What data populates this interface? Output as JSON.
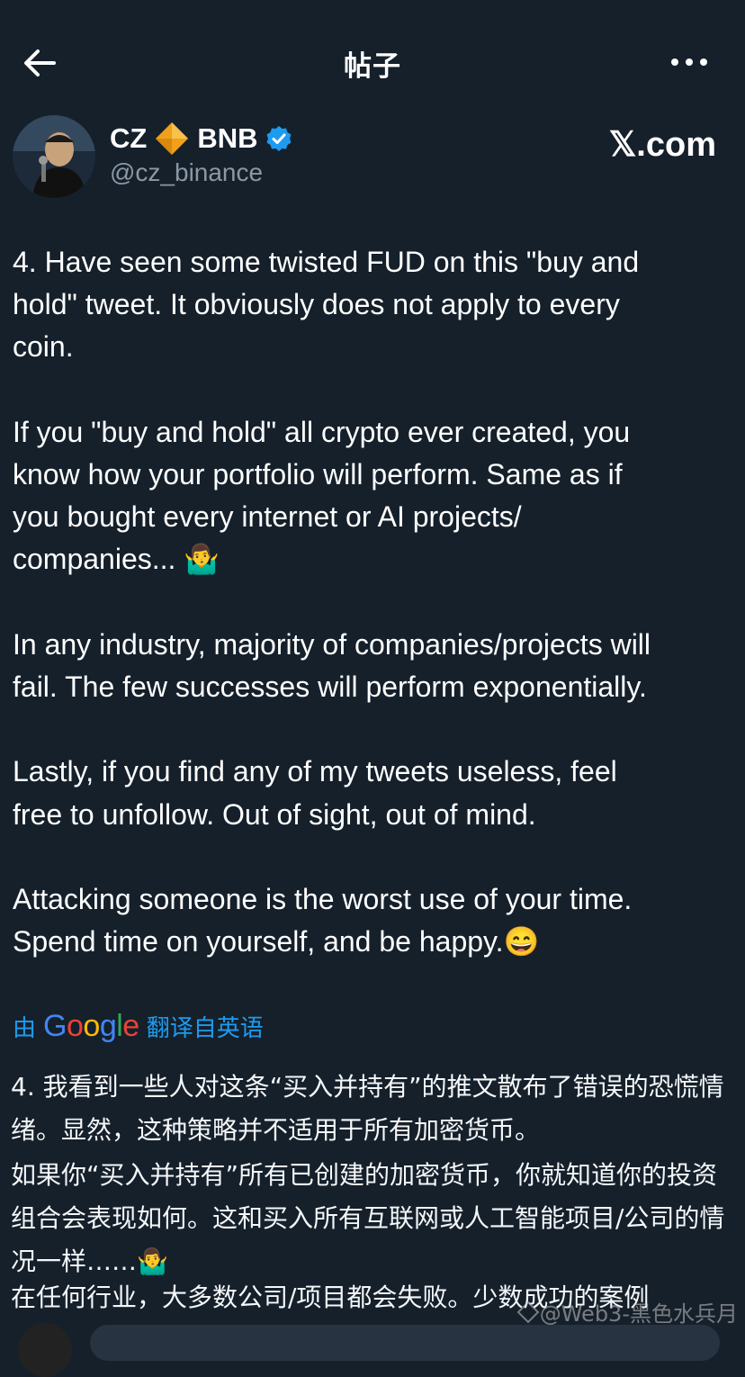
{
  "header": {
    "title": "帖子",
    "back_icon": "arrow-left-icon",
    "more_icon": "more-horizontal-icon"
  },
  "author": {
    "name_part1": "CZ",
    "name_part2": "BNB",
    "handle": "@cz_binance",
    "verified": true
  },
  "brand": {
    "xcom": "𝕏.com"
  },
  "tweet": {
    "paragraphs": [
      "4. Have seen some twisted FUD on this \"buy and\nhold\" tweet. It obviously does not apply to every\ncoin.",
      "If you \"buy and hold\" all crypto ever created, you\nknow how your portfolio will perform. Same as if\nyou bought every internet or AI projects/\ncompanies... 🤷‍♂️",
      "In any industry, majority of companies/projects will\nfail. The few successes will perform exponentially.",
      "Lastly, if you find any of my tweets useless, feel\nfree to unfollow. Out of sight, out of mind.",
      "Attacking someone is the worst use of your time.\nSpend time on yourself, and be happy.😄"
    ]
  },
  "translation": {
    "prefix": "由",
    "google": "Google",
    "suffix": "翻译自英语",
    "paragraphs": [
      "4. 我看到一些人对这条“买入并持有”的推文散布了错误的恐慌情绪。显然，这种策略并不适用于所有加密货币。",
      "如果你“买入并持有”所有已创建的加密货币，你就知道你的投资组合会表现如何。这和买入所有互联网或人工智能项目/公司的情况一样……🤷‍♂️",
      "在任何行业，大多数公司/项目都会失败。少数成功的案例"
    ]
  },
  "watermark": "@Web3-黑色水兵月",
  "colors": {
    "background": "#15202b",
    "muted": "#8b98a5",
    "accent": "#1d9bf0"
  }
}
